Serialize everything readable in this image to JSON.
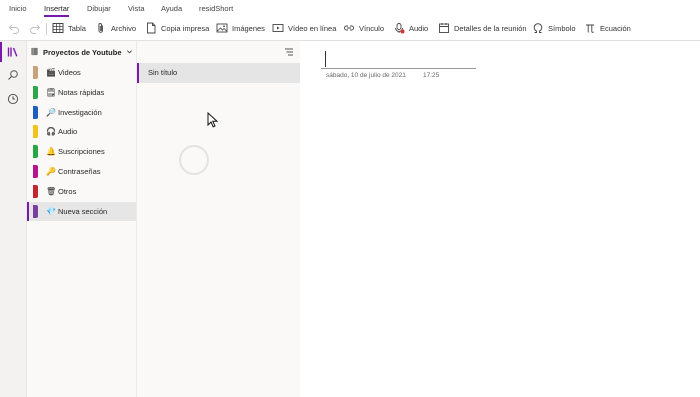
{
  "menu": {
    "tabs": [
      "Inicio",
      "Insertar",
      "Dibujar",
      "Vista",
      "Ayuda",
      "residShort"
    ],
    "active": "Insertar"
  },
  "ribbon": {
    "tabla": "Tabla",
    "archivo": "Archivo",
    "copia_impresa": "Copia impresa",
    "imagenes": "Imágenes",
    "video": "Vídeo en línea",
    "vinculo": "Vínculo",
    "audio": "Audio",
    "detalles": "Detalles de la reunión",
    "simbolo": "Símbolo",
    "ecuacion": "Ecuación"
  },
  "notebook": {
    "name": "Proyectos de Youtube"
  },
  "sections": [
    {
      "label": "Videos",
      "color": "#c8a27a",
      "emoji": "🎬"
    },
    {
      "label": "Notas rápidas",
      "color": "#2ba84a",
      "emoji": "🗒"
    },
    {
      "label": "Investigación",
      "color": "#1f5fbf",
      "emoji": "🔎"
    },
    {
      "label": "Audio",
      "color": "#f0c419",
      "emoji": "🎧"
    },
    {
      "label": "Suscripciones",
      "color": "#29a745",
      "emoji": "🔔"
    },
    {
      "label": "Contraseñas",
      "color": "#b8128f",
      "emoji": "🔑"
    },
    {
      "label": "Otros",
      "color": "#c4262e",
      "emoji": "🗑"
    },
    {
      "label": "Nueva sección",
      "color": "#7a3ea1",
      "emoji": "💎",
      "selected": true
    }
  ],
  "pages": [
    {
      "title": "Sin título",
      "selected": true
    }
  ],
  "canvas": {
    "date": "sábado, 10 de julio de 2021",
    "time": "17:25"
  },
  "colors": {
    "accent": "#7719aa"
  }
}
